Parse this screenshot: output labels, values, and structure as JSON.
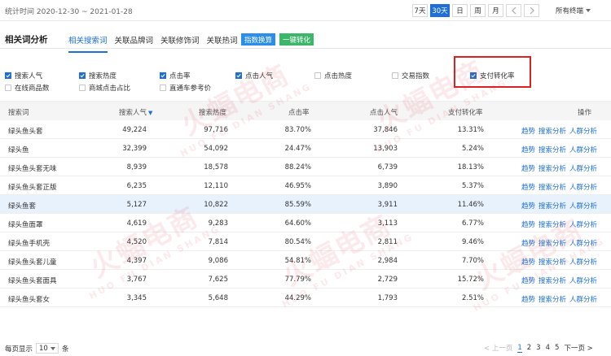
{
  "header": {
    "date_range": "统计时间 2020-12-30 ~ 2021-01-28",
    "periods": [
      "7天",
      "30天",
      "日",
      "周",
      "月"
    ],
    "active_period": "30天",
    "prev_icon": "chevron-left-icon",
    "next_icon": "chevron-right-icon",
    "terminal": "所有终端"
  },
  "tabbar": {
    "title": "相关词分析",
    "tabs": [
      "相关搜索词",
      "关联品牌词",
      "关联修饰词",
      "关联热词"
    ],
    "active_tab": "相关搜索词",
    "index_convert": "指数换算",
    "one_click_convert": "一键转化"
  },
  "metrics": {
    "m1": {
      "label": "搜索人气",
      "checked": true
    },
    "m2": {
      "label": "搜索热度",
      "checked": true
    },
    "m3": {
      "label": "点击率",
      "checked": true
    },
    "m4": {
      "label": "点击人气",
      "checked": true
    },
    "m5": {
      "label": "点击热度",
      "checked": false
    },
    "m6": {
      "label": "交易指数",
      "checked": false
    },
    "m7": {
      "label": "支付转化率",
      "checked": true
    },
    "m8": {
      "label": "在线商品数",
      "checked": false
    },
    "m9": {
      "label": "商城点击占比",
      "checked": false
    },
    "m10": {
      "label": "直通车参考价",
      "checked": false
    }
  },
  "table": {
    "headers": {
      "keyword": "搜索词",
      "search_popularity": "搜索人气",
      "search_heat": "搜索热度",
      "ctr": "点击率",
      "click_popularity": "点击人气",
      "conversion": "支付转化率",
      "ops": "操作"
    },
    "op_labels": {
      "trend": "趋势",
      "search_analysis": "搜索分析",
      "crowd_analysis": "人群分析"
    },
    "rows": [
      {
        "keyword": "绿头鱼头套",
        "search_popularity": "49,224",
        "search_heat": "97,716",
        "ctr": "83.70%",
        "click_popularity": "37,846",
        "conversion": "13.31%"
      },
      {
        "keyword": "绿头鱼",
        "search_popularity": "32,399",
        "search_heat": "54,092",
        "ctr": "24.47%",
        "click_popularity": "13,903",
        "conversion": "5.24%"
      },
      {
        "keyword": "绿头鱼头套无味",
        "search_popularity": "8,939",
        "search_heat": "18,578",
        "ctr": "88.24%",
        "click_popularity": "6,739",
        "conversion": "18.13%"
      },
      {
        "keyword": "绿头鱼头套正版",
        "search_popularity": "6,235",
        "search_heat": "12,110",
        "ctr": "46.95%",
        "click_popularity": "3,890",
        "conversion": "5.37%"
      },
      {
        "keyword": "绿头鱼套",
        "search_popularity": "5,127",
        "search_heat": "10,822",
        "ctr": "85.59%",
        "click_popularity": "3,911",
        "conversion": "11.46%"
      },
      {
        "keyword": "绿头鱼面罩",
        "search_popularity": "4,619",
        "search_heat": "9,283",
        "ctr": "64.60%",
        "click_popularity": "3,113",
        "conversion": "6.77%"
      },
      {
        "keyword": "绿头鱼手机壳",
        "search_popularity": "4,520",
        "search_heat": "7,814",
        "ctr": "80.54%",
        "click_popularity": "2,811",
        "conversion": "9.46%"
      },
      {
        "keyword": "绿头鱼头套儿童",
        "search_popularity": "4,397",
        "search_heat": "9,086",
        "ctr": "54.81%",
        "click_popularity": "2,984",
        "conversion": "7.70%"
      },
      {
        "keyword": "绿头鱼头套面具",
        "search_popularity": "3,767",
        "search_heat": "7,625",
        "ctr": "77.79%",
        "click_popularity": "2,729",
        "conversion": "15.72%"
      },
      {
        "keyword": "绿头鱼头套女",
        "search_popularity": "3,345",
        "search_heat": "5,648",
        "ctr": "44.29%",
        "click_popularity": "1,793",
        "conversion": "2.51%"
      }
    ]
  },
  "footer": {
    "per_page_label": "每页显示",
    "per_page_value": "10",
    "per_page_unit": "条",
    "prev": "< 上一页",
    "pages": [
      "1",
      "2",
      "3",
      "4",
      "5"
    ],
    "current_page": "1",
    "next": "下一页 >"
  },
  "watermark": {
    "cn": "火蝠电商",
    "en": "HUO FU DIAN SHANG"
  },
  "colors": {
    "accent": "#1e6fd9",
    "highlight_row": "#e8f2fd",
    "annotation_box": "#e02020",
    "convert_green": "#3cb66a",
    "index_blue": "#2b8ee8"
  }
}
